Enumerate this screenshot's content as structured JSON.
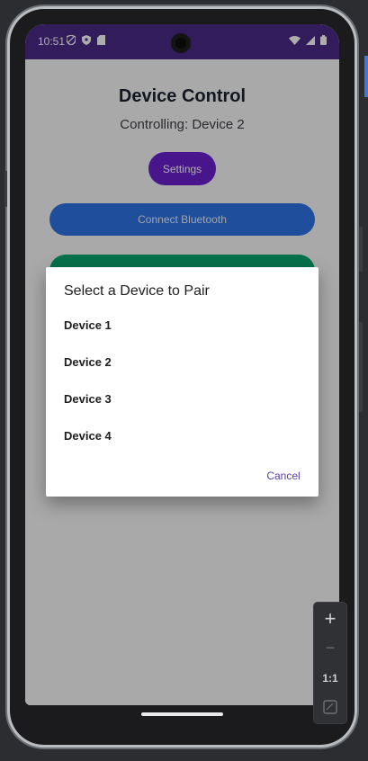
{
  "status_bar": {
    "time": "10:51",
    "left_icons": [
      "shield-icon",
      "shield-check-icon",
      "sd-card-icon"
    ],
    "right_icons": [
      "wifi-icon",
      "cellular-signal-icon",
      "battery-icon"
    ]
  },
  "app": {
    "title": "Device Control",
    "subtitle": "Controlling: Device 2",
    "settings_label": "Settings",
    "connect_label": "Connect Bluetooth"
  },
  "dialog": {
    "title": "Select a Device to Pair",
    "devices": [
      "Device 1",
      "Device 2",
      "Device 3",
      "Device 4"
    ],
    "cancel_label": "Cancel"
  },
  "zoom_controls": {
    "plus": "+",
    "minus": "−",
    "one_to_one": "1:1"
  },
  "colors": {
    "status_bar": "#4a2a86",
    "settings_button": "#6a1fd0",
    "connect_button": "#2f74e6",
    "green_button": "#0aa76f",
    "cancel_text": "#5a3da8"
  }
}
